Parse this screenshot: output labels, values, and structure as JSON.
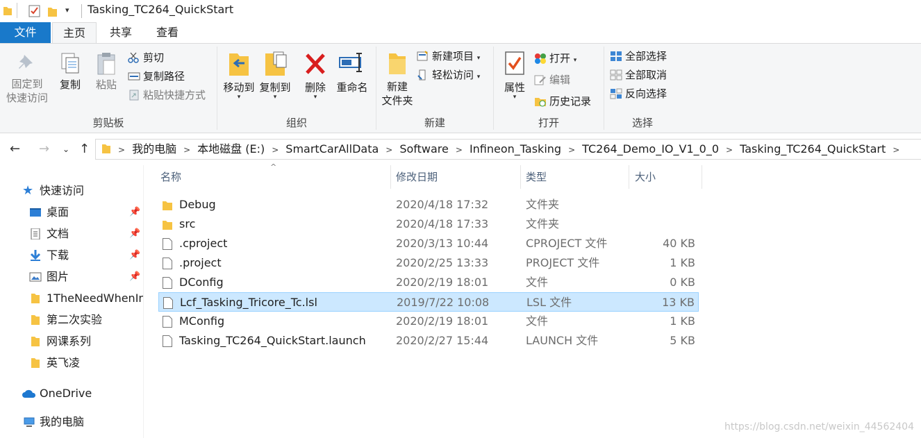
{
  "window": {
    "title": "Tasking_TC264_QuickStart"
  },
  "tabs": {
    "file": "文件",
    "home": "主页",
    "share": "共享",
    "view": "查看"
  },
  "ribbon": {
    "clipboard": {
      "label": "剪贴板",
      "pin_line1": "固定到",
      "pin_line2": "快速访问",
      "copy": "复制",
      "paste": "粘贴",
      "cut": "剪切",
      "copy_path": "复制路径",
      "paste_shortcut": "粘贴快捷方式"
    },
    "organize": {
      "label": "组织",
      "move_to": "移动到",
      "copy_to": "复制到",
      "delete": "删除",
      "rename": "重命名"
    },
    "new": {
      "label": "新建",
      "new_folder_line1": "新建",
      "new_folder_line2": "文件夹",
      "new_item": "新建项目",
      "easy_access": "轻松访问"
    },
    "open": {
      "label": "打开",
      "properties": "属性",
      "open": "打开",
      "edit": "编辑",
      "history": "历史记录"
    },
    "select": {
      "label": "选择",
      "select_all": "全部选择",
      "select_none": "全部取消",
      "invert": "反向选择"
    }
  },
  "breadcrumb": [
    "我的电脑",
    "本地磁盘 (E:)",
    "SmartCarAllData",
    "Software",
    "Infineon_Tasking",
    "TC264_Demo_IO_V1_0_0",
    "Tasking_TC264_QuickStart"
  ],
  "sidebar": {
    "quick_access": "快速访问",
    "items": [
      {
        "label": "桌面",
        "pinned": true
      },
      {
        "label": "文档",
        "pinned": true
      },
      {
        "label": "下载",
        "pinned": true
      },
      {
        "label": "图片",
        "pinned": true
      },
      {
        "label": "1TheNeedWhenIn",
        "pinned": false
      },
      {
        "label": "第二次实验",
        "pinned": false
      },
      {
        "label": "网课系列",
        "pinned": false
      },
      {
        "label": "英飞凌",
        "pinned": false
      }
    ],
    "onedrive": "OneDrive",
    "this_pc": "我的电脑"
  },
  "columns": {
    "name": "名称",
    "date": "修改日期",
    "type": "类型",
    "size": "大小"
  },
  "files": [
    {
      "name": "Debug",
      "date": "2020/4/18 17:32",
      "type": "文件夹",
      "size": "",
      "kind": "folder"
    },
    {
      "name": "src",
      "date": "2020/4/18 17:33",
      "type": "文件夹",
      "size": "",
      "kind": "folder"
    },
    {
      "name": ".cproject",
      "date": "2020/3/13 10:44",
      "type": "CPROJECT 文件",
      "size": "40 KB",
      "kind": "file"
    },
    {
      "name": ".project",
      "date": "2020/2/25 13:33",
      "type": "PROJECT 文件",
      "size": "1 KB",
      "kind": "file"
    },
    {
      "name": "DConfig",
      "date": "2020/2/19 18:01",
      "type": "文件",
      "size": "0 KB",
      "kind": "file"
    },
    {
      "name": "Lcf_Tasking_Tricore_Tc.lsl",
      "date": "2019/7/22 10:08",
      "type": "LSL 文件",
      "size": "13 KB",
      "kind": "file",
      "selected": true
    },
    {
      "name": "MConfig",
      "date": "2020/2/19 18:01",
      "type": "文件",
      "size": "1 KB",
      "kind": "file"
    },
    {
      "name": "Tasking_TC264_QuickStart.launch",
      "date": "2020/2/27 15:44",
      "type": "LAUNCH 文件",
      "size": "5 KB",
      "kind": "file"
    }
  ],
  "watermark": "https://blog.csdn.net/weixin_44562404",
  "colors": {
    "accent": "#1979ca",
    "selection": "#cce8ff",
    "folder": "#f6c343"
  }
}
